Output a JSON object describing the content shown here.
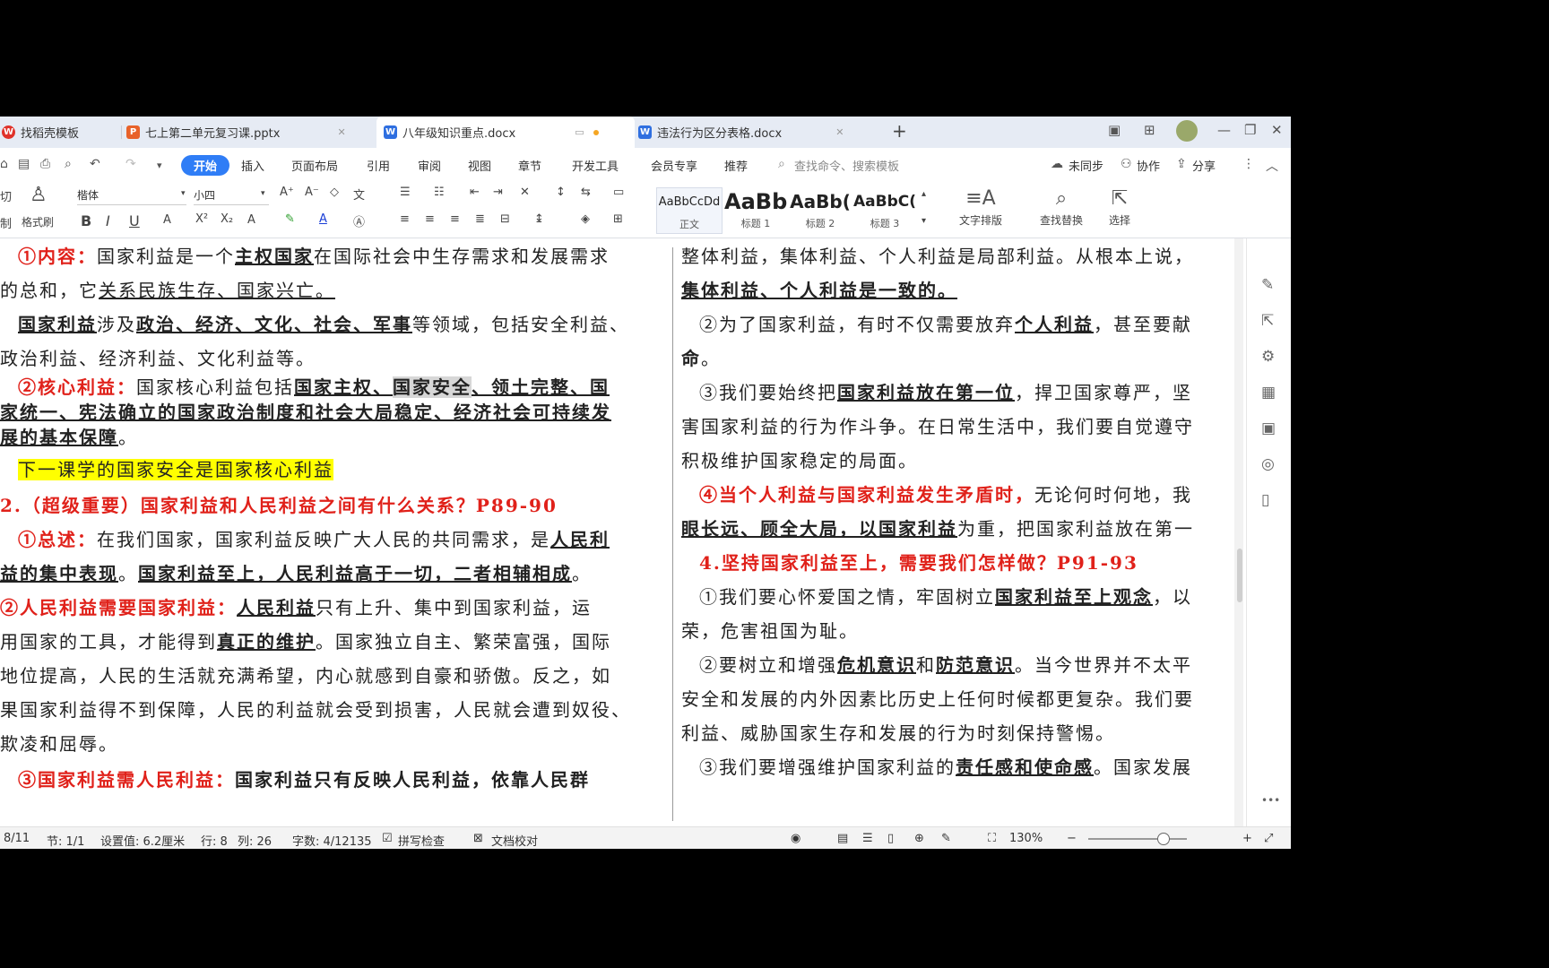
{
  "tabs": [
    {
      "label": "找稻壳模板",
      "icon": "docer-icon",
      "color": "#e0322a"
    },
    {
      "label": "七上第二单元复习课.pptx",
      "icon": "pptx-icon",
      "color": "#e8622a"
    },
    {
      "label": "八年级知识重点.docx",
      "icon": "docx-icon",
      "color": "#2f6fe0"
    },
    {
      "label": "违法行为区分表格.docx",
      "icon": "docx-icon",
      "color": "#2f6fe0"
    }
  ],
  "window_controls": {
    "layout": "3⃣",
    "grid": "⊞",
    "min": "—",
    "restore": "❐",
    "close": "✕"
  },
  "menu": {
    "items": [
      "开始",
      "插入",
      "页面布局",
      "引用",
      "审阅",
      "视图",
      "章节",
      "开发工具",
      "会员专享",
      "推荐"
    ],
    "search": "查找命令、搜索模板",
    "sync": "未同步",
    "collab": "协作",
    "share": "分享"
  },
  "ribbon": {
    "cut": "切",
    "paste_label": "制",
    "format_painter": "格式刷",
    "font_name": "楷体",
    "font_size": "小四",
    "styles": [
      {
        "sample": "AaBbCcDd",
        "label": "正文"
      },
      {
        "sample": "AaBb",
        "label": "标题 1"
      },
      {
        "sample": "AaBb(",
        "label": "标题 2"
      },
      {
        "sample": "AaBbC(",
        "label": "标题 3"
      }
    ],
    "text_layout": "文字排版",
    "find_replace": "查找替换",
    "select": "选择"
  },
  "doc": {
    "left": [
      [
        [
          "red",
          "①内容："
        ],
        [
          "n",
          "国家利益是一个"
        ],
        [
          "bu",
          "主权国家"
        ],
        [
          "n",
          "在国际社会中生存需求和发展需求"
        ]
      ],
      [
        [
          "n",
          "的总和，它"
        ],
        [
          "u",
          "关系民族生存、国家兴亡。"
        ]
      ],
      [
        [
          "bu",
          "国家利益"
        ],
        [
          "n",
          "涉及"
        ],
        [
          "bu",
          "政治、经济、文化、社会、军事"
        ],
        [
          "n",
          "等领域，包括安全利益、"
        ]
      ],
      [
        [
          "n",
          "政治利益、经济利益、文化利益等。"
        ]
      ],
      [
        [
          "red",
          "②核心利益："
        ],
        [
          "n",
          "国家核心利益包括"
        ],
        [
          "bu",
          "国家主权、"
        ],
        [
          "hl-gray",
          "国家安全"
        ],
        [
          "bu",
          "、领土完整、国"
        ]
      ],
      [
        [
          "bu",
          "家统一、宪法确立的国家政治制度和社会大局稳定、经济社会可持续发"
        ]
      ],
      [
        [
          "bu",
          "展的基本保障"
        ],
        [
          "n",
          "。"
        ]
      ],
      [
        [
          "hl-yellow",
          "下一课学的国家安全是国家核心利益"
        ]
      ],
      [
        [
          "red",
          "2.（超级重要）国家利益和人民利益之间有什么关系？P89-90"
        ]
      ],
      [
        [
          "red",
          "①总述："
        ],
        [
          "n",
          "在我们国家，国家利益反映广大人民的共同需求，是"
        ],
        [
          "bu",
          "人民利"
        ]
      ],
      [
        [
          "bu",
          "益的集中表现"
        ],
        [
          "n",
          "。"
        ],
        [
          "bu",
          "国家利益至上，人民利益高于一切，二者相辅相成"
        ],
        [
          "n",
          "。"
        ]
      ],
      [
        [
          "red",
          "②人民利益需要国家利益："
        ],
        [
          "bu",
          "人民利益"
        ],
        [
          "n",
          "只有上升、集中到国家利益，运"
        ]
      ],
      [
        [
          "n",
          "用国家的工具，才能得到"
        ],
        [
          "bu",
          "真正的维护"
        ],
        [
          "n",
          "。国家独立自主、繁荣富强，国际"
        ]
      ],
      [
        [
          "n",
          "地位提高，人民的生活就充满希望，内心就感到自豪和骄傲。反之，如"
        ]
      ],
      [
        [
          "n",
          "果国家利益得不到保障，人民的利益就会受到损害，人民就会遭到奴役、"
        ]
      ],
      [
        [
          "n",
          "欺凌和屈辱。"
        ]
      ],
      [
        [
          "red",
          "③国家利益需人民利益："
        ],
        [
          "b",
          "国家利益只有反映人民利益，依靠人民群"
        ]
      ]
    ],
    "right": [
      [
        [
          "n",
          "整体利益，集体利益、个人利益是局部利益。从根本上说，"
        ]
      ],
      [
        [
          "bu",
          "集体利益、个人利益是一致的。"
        ]
      ],
      [
        [
          "n",
          "②为了国家利益，有时不仅需要放弃"
        ],
        [
          "bu",
          "个人利益"
        ],
        [
          "n",
          "，甚至要献"
        ]
      ],
      [
        [
          "b",
          "命"
        ],
        [
          "n",
          "。"
        ]
      ],
      [
        [
          "n",
          "③我们要始终把"
        ],
        [
          "bu",
          "国家利益放在第一位"
        ],
        [
          "n",
          "，捍卫国家尊严，坚"
        ]
      ],
      [
        [
          "n",
          "害国家利益的行为作斗争。在日常生活中，我们要自觉遵守"
        ]
      ],
      [
        [
          "n",
          "积极维护国家稳定的局面。"
        ]
      ],
      [
        [
          "red",
          "④当个人利益与国家利益发生矛盾时，"
        ],
        [
          "n",
          "无论何时何地，我"
        ]
      ],
      [
        [
          "bu",
          "眼长远、顾全大局，以国家利益"
        ],
        [
          "n",
          "为重，把国家利益放在第一"
        ]
      ],
      [
        [
          "red",
          "4.坚持国家利益至上，需要我们怎样做？P91-93"
        ]
      ],
      [
        [
          "n",
          "①我们要心怀爱国之情，牢固树立"
        ],
        [
          "bu",
          "国家利益至上观念"
        ],
        [
          "n",
          "，以"
        ]
      ],
      [
        [
          "n",
          "荣，危害祖国为耻。"
        ]
      ],
      [
        [
          "n",
          "②要树立和增强"
        ],
        [
          "bu",
          "危机意识"
        ],
        [
          "n",
          "和"
        ],
        [
          "bu",
          "防范意识"
        ],
        [
          "n",
          "。当今世界并不太平"
        ]
      ],
      [
        [
          "n",
          "安全和发展的内外因素比历史上任何时候都更复杂。我们要"
        ]
      ],
      [
        [
          "n",
          "利益、威胁国家生存和发展的行为时刻保持警惕。"
        ]
      ],
      [
        [
          "n",
          "③我们要增强维护国家利益的"
        ],
        [
          "bu",
          "责任感和使命感"
        ],
        [
          "n",
          "。国家发展"
        ]
      ]
    ]
  },
  "status": {
    "page": "8/11",
    "section": "节: 1/1",
    "setting": "设置值: 6.2厘米",
    "row": "行: 8",
    "col": "列: 26",
    "words": "字数: 4/12135",
    "spell": "拼写检查",
    "proof": "文档校对",
    "zoom": "130%"
  },
  "colors": {
    "accent": "#2f7df6",
    "heading_red": "#e0211a",
    "highlight_yellow": "#ffff00"
  }
}
